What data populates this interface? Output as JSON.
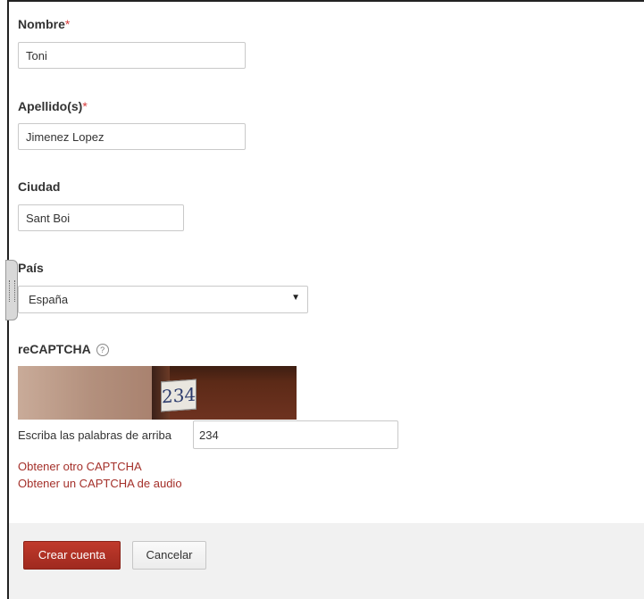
{
  "form": {
    "nombre": {
      "label": "Nombre",
      "required_mark": "*",
      "value": "Toni"
    },
    "apellidos": {
      "label": "Apellido(s)",
      "required_mark": "*",
      "value": "Jimenez Lopez"
    },
    "ciudad": {
      "label": "Ciudad",
      "value": "Sant Boi"
    },
    "pais": {
      "label": "País",
      "selected": "España"
    },
    "recaptcha": {
      "label": "reCAPTCHA",
      "help_icon": "question-circle-icon",
      "image_text": "234",
      "input_label": "Escriba las palabras de arriba",
      "input_value": "234",
      "link_other": "Obtener otro CAPTCHA",
      "link_audio": "Obtener un CAPTCHA de audio"
    }
  },
  "actions": {
    "create_label": "Crear cuenta",
    "cancel_label": "Cancelar"
  },
  "colors": {
    "required": "#d73a3a",
    "link": "#a4302a",
    "primary_button": "#b03226",
    "footer_bg": "#f1f1f1"
  }
}
